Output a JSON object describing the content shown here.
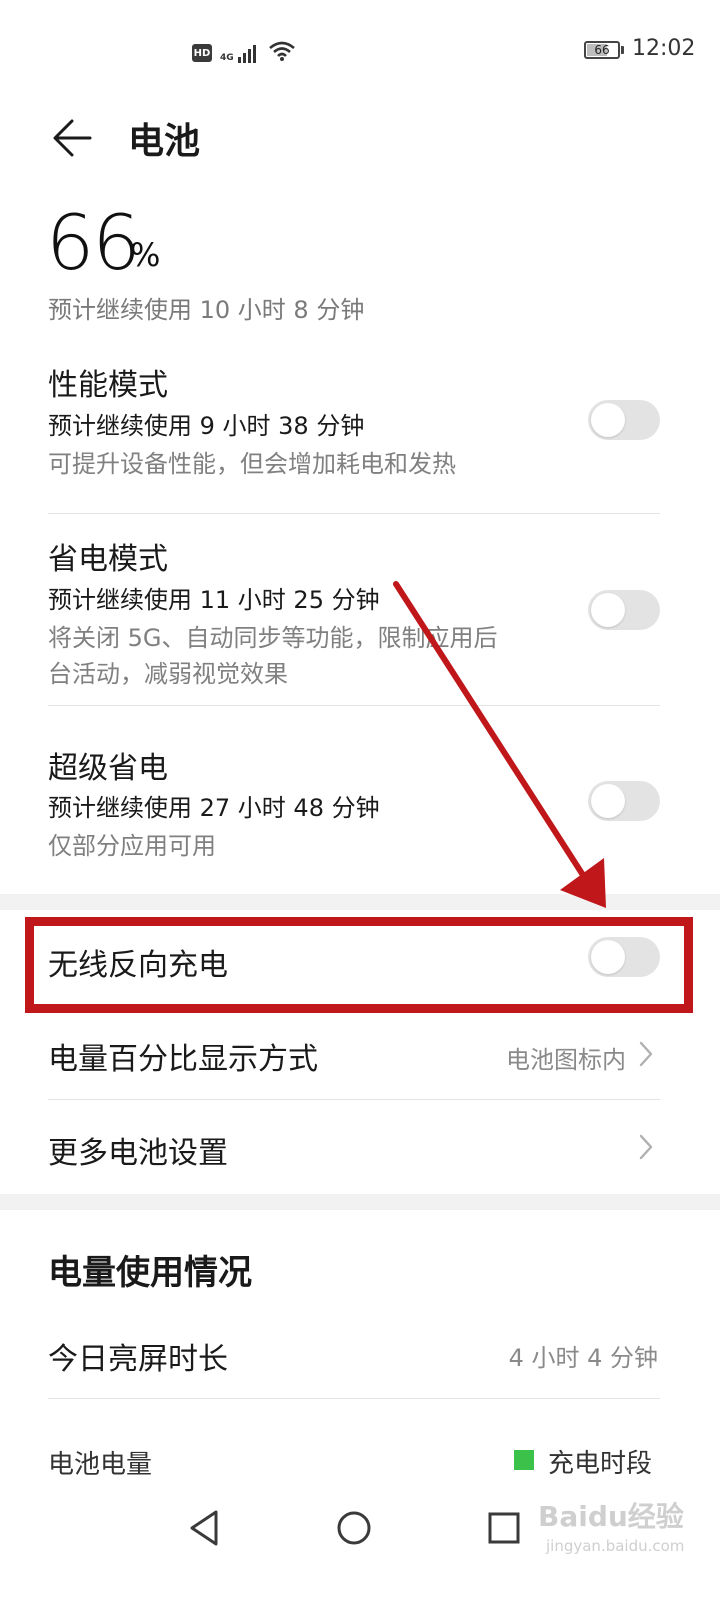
{
  "status_bar": {
    "hd": "HD",
    "network": "4G",
    "battery_level": "66",
    "time": "12:02",
    "icons": [
      "hd-icon",
      "signal-icon",
      "wifi-icon",
      "battery-icon"
    ]
  },
  "header": {
    "back_icon": "back-arrow-icon",
    "title": "电池"
  },
  "battery_summary": {
    "percent": "66",
    "percent_sign": "%",
    "estimate": "预计继续使用 10 小时 8 分钟"
  },
  "modes": [
    {
      "title": "性能模式",
      "estimate": "预计继续使用 9 小时 38 分钟",
      "desc_line1": "可提升设备性能，但会增加耗电和发热",
      "desc_line2": "",
      "enabled": false
    },
    {
      "title": "省电模式",
      "estimate": "预计继续使用 11 小时 25 分钟",
      "desc_line1": "将关闭 5G、自动同步等功能，限制应用后",
      "desc_line2": "台活动，减弱视觉效果",
      "enabled": false
    },
    {
      "title": "超级省电",
      "estimate": "预计继续使用 27 小时 48 分钟",
      "desc_line1": "仅部分应用可用",
      "desc_line2": "",
      "enabled": false
    }
  ],
  "wireless_reverse": {
    "label": "无线反向充电",
    "enabled": false
  },
  "percentage_display": {
    "label": "电量百分比显示方式",
    "value": "电池图标内"
  },
  "more_settings": {
    "label": "更多电池设置"
  },
  "usage": {
    "section_title": "电量使用情况",
    "screen_on_label": "今日亮屏时长",
    "screen_on_value": "4 小时 4 分钟",
    "battery_level_label": "电池电量",
    "legend_label": "充电时段",
    "legend_color": "#3cc24a"
  },
  "annotation": {
    "color": "#c0171b"
  },
  "nav_bar": {
    "icons": [
      "nav-back-icon",
      "nav-home-icon",
      "nav-recents-icon"
    ]
  },
  "watermark": {
    "text": "Baidu经验",
    "sub": "jingyan.baidu.com"
  }
}
